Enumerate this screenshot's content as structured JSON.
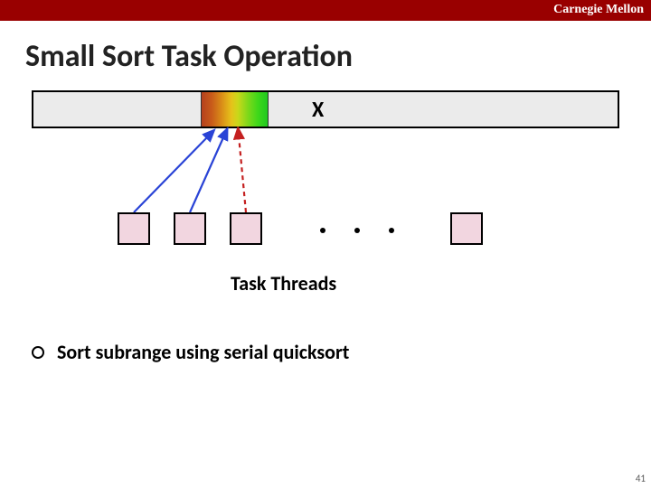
{
  "header": {
    "org": "Carnegie Mellon"
  },
  "slide": {
    "title": "Small Sort Task Operation",
    "array_label": "X",
    "threads_label": "Task Threads",
    "bullet": "Sort subrange using serial quicksort",
    "page_number": "41"
  }
}
